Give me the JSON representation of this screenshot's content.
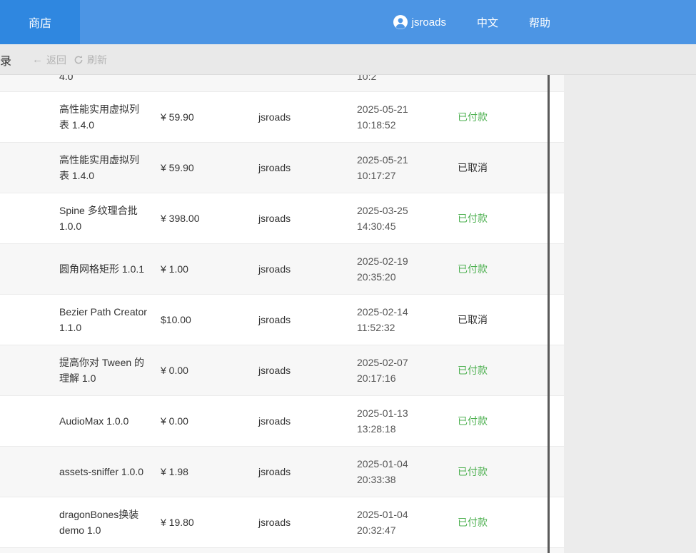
{
  "header": {
    "store_label": "商店",
    "user_name": "jsroads",
    "lang_label": "中文",
    "help_label": "帮助"
  },
  "toolbar": {
    "record_fragment": "录",
    "back_label": "返回",
    "refresh_label": "刷新"
  },
  "table": {
    "partial_top_row": {
      "name_fragment": "4.0",
      "time_fragment": "10:2"
    },
    "rows": [
      {
        "name": "高性能实用虚拟列表 1.4.0",
        "price": "¥ 59.90",
        "user": "jsroads",
        "date": "2025-05-21",
        "time": "10:18:52",
        "status": "已付款",
        "paid": true
      },
      {
        "name": "高性能实用虚拟列表 1.4.0",
        "price": "¥ 59.90",
        "user": "jsroads",
        "date": "2025-05-21",
        "time": "10:17:27",
        "status": "已取消",
        "paid": false
      },
      {
        "name": "Spine 多纹理合批 1.0.0",
        "price": "¥ 398.00",
        "user": "jsroads",
        "date": "2025-03-25",
        "time": "14:30:45",
        "status": "已付款",
        "paid": true
      },
      {
        "name": "圆角网格矩形 1.0.1",
        "price": "¥ 1.00",
        "user": "jsroads",
        "date": "2025-02-19",
        "time": "20:35:20",
        "status": "已付款",
        "paid": true
      },
      {
        "name": "Bezier Path Creator 1.1.0",
        "price": "$10.00",
        "user": "jsroads",
        "date": "2025-02-14",
        "time": "11:52:32",
        "status": "已取消",
        "paid": false
      },
      {
        "name": "提高你对 Tween 的理解 1.0",
        "price": "¥ 0.00",
        "user": "jsroads",
        "date": "2025-02-07",
        "time": "20:17:16",
        "status": "已付款",
        "paid": true
      },
      {
        "name": "AudioMax 1.0.0",
        "price": "¥ 0.00",
        "user": "jsroads",
        "date": "2025-01-13",
        "time": "13:28:18",
        "status": "已付款",
        "paid": true
      },
      {
        "name": "assets-sniffer 1.0.0",
        "price": "¥ 1.98",
        "user": "jsroads",
        "date": "2025-01-04",
        "time": "20:33:38",
        "status": "已付款",
        "paid": true
      },
      {
        "name": "dragonBones换装 demo 1.0",
        "price": "¥ 19.80",
        "user": "jsroads",
        "date": "2025-01-04",
        "time": "20:32:47",
        "status": "已付款",
        "paid": true
      }
    ]
  },
  "colors": {
    "header_bg": "#4c95e4",
    "store_tab_bg": "#2f87e0",
    "paid_green": "#4db050",
    "cancelled_text": "#333333",
    "toolbar_bg": "#e9e9e9"
  }
}
